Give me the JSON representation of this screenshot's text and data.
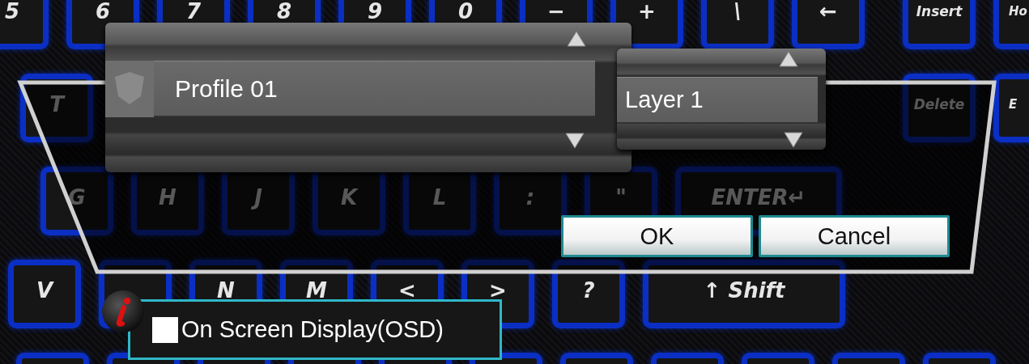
{
  "keyboard": {
    "rows": [
      {
        "keys": [
          {
            "kind": "key",
            "label": "5"
          },
          {
            "kind": "key",
            "label": "6"
          },
          {
            "kind": "key",
            "label": "7"
          },
          {
            "kind": "key",
            "label": "8"
          },
          {
            "kind": "key",
            "label": "9"
          },
          {
            "kind": "key",
            "label": "0"
          },
          {
            "kind": "key",
            "label": "−"
          },
          {
            "kind": "key",
            "label": "+"
          },
          {
            "kind": "key",
            "label": "\\"
          },
          {
            "kind": "key",
            "label": "←"
          },
          {
            "kind": "gap"
          },
          {
            "kind": "key",
            "label": "Insert"
          },
          {
            "kind": "edge",
            "label": "Ho"
          }
        ]
      },
      {
        "keys": [
          {
            "kind": "key",
            "label": "T"
          },
          {
            "kind": "blank"
          },
          {
            "kind": "blank"
          },
          {
            "kind": "blank"
          },
          {
            "kind": "blank"
          },
          {
            "kind": "blank"
          },
          {
            "kind": "blank"
          },
          {
            "kind": "blank"
          },
          {
            "kind": "blank"
          },
          {
            "kind": "gap"
          },
          {
            "kind": "key",
            "label": "Delete"
          },
          {
            "kind": "edge",
            "label": "E"
          }
        ]
      },
      {
        "keys": [
          {
            "kind": "key",
            "label": "G"
          },
          {
            "kind": "key",
            "label": "H"
          },
          {
            "kind": "key",
            "label": "J"
          },
          {
            "kind": "key",
            "label": "K"
          },
          {
            "kind": "key",
            "label": "L"
          },
          {
            "kind": "key",
            "label": ":"
          },
          {
            "kind": "key",
            "label": "\""
          },
          {
            "kind": "wide",
            "label": "ENTER↵"
          }
        ]
      },
      {
        "keys": [
          {
            "kind": "key",
            "label": "V"
          },
          {
            "kind": "blank"
          },
          {
            "kind": "key",
            "label": "N"
          },
          {
            "kind": "key",
            "label": "M"
          },
          {
            "kind": "key",
            "label": "<"
          },
          {
            "kind": "key",
            "label": ">"
          },
          {
            "kind": "key",
            "label": "?"
          },
          {
            "kind": "shift",
            "label": "↑ Shift"
          }
        ]
      },
      {
        "keys": [
          {
            "kind": "blank"
          },
          {
            "kind": "blank"
          },
          {
            "kind": "blank"
          },
          {
            "kind": "blank"
          },
          {
            "kind": "blank"
          },
          {
            "kind": "blank"
          },
          {
            "kind": "blank"
          },
          {
            "kind": "blank"
          },
          {
            "kind": "blank"
          },
          {
            "kind": "blank"
          },
          {
            "kind": "blank"
          }
        ]
      }
    ]
  },
  "dialog": {
    "profile": {
      "value": "Profile 01"
    },
    "layer": {
      "value": "Layer 1"
    },
    "buttons": [
      {
        "label": "OK"
      },
      {
        "label": "Cancel"
      }
    ]
  },
  "osd": {
    "label": "On Screen Display(OSD)",
    "checked": false
  }
}
